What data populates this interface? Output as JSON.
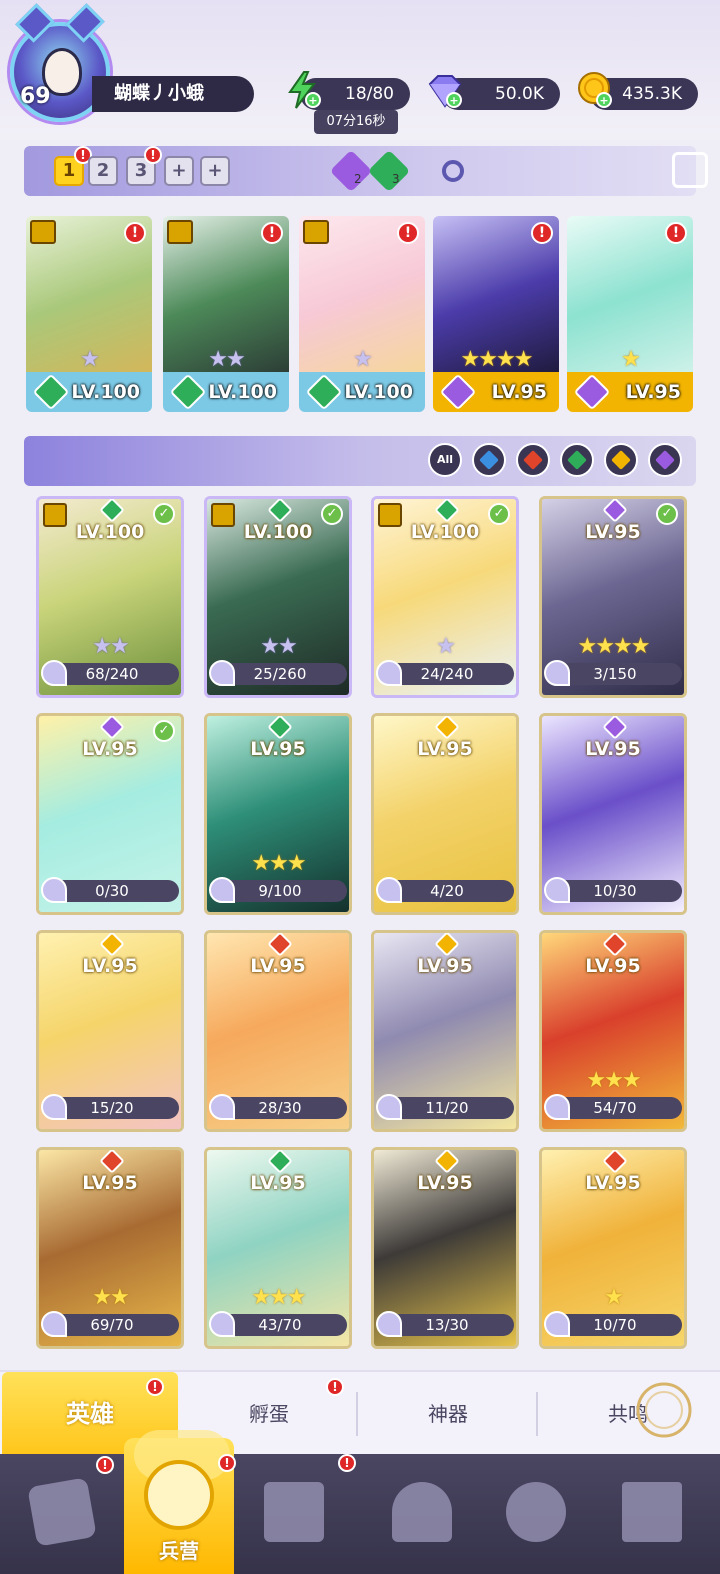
{
  "player": {
    "level": "69",
    "name": "蝴蝶丿小蛾"
  },
  "resources": {
    "energy": "18/80",
    "energy_timer": "07分16秒",
    "gems": "50.0K",
    "gold": "435.3K"
  },
  "team_tabs": [
    "1",
    "2",
    "3",
    "+",
    "+"
  ],
  "team_gems": [
    {
      "count": "2",
      "color": "#9b5be0"
    },
    {
      "count": "3",
      "color": "#2fae5a"
    }
  ],
  "team_slots": [
    {
      "level": "LV.100",
      "stars": "★",
      "element_color": "#2fae5a",
      "bar": "#7cc9e6",
      "art": "linear-gradient(160deg,#e9f2d8,#a9c87a 50%,#d5b65a)"
    },
    {
      "level": "LV.100",
      "stars": "★★",
      "element_color": "#2fae5a",
      "bar": "#7cc9e6",
      "art": "linear-gradient(160deg,#e5f0e8,#4d8a59 50%,#2b3b35)"
    },
    {
      "level": "LV.100",
      "stars": "★",
      "element_color": "#2fae5a",
      "bar": "#7cc9e6",
      "art": "linear-gradient(160deg,#fde8ee,#f7c9d6 50%,#f5d79a)"
    },
    {
      "level": "LV.95",
      "stars": "★★★★",
      "element_color": "#9b5be0",
      "bar": "#f2b400",
      "art": "linear-gradient(160deg,#c6c0f5,#4b3caa 50%,#1d1a3a)"
    },
    {
      "level": "LV.95",
      "stars": "★",
      "element_color": "#9b5be0",
      "bar": "#f2b400",
      "art": "linear-gradient(160deg,#e9fbf6,#8de2d0 50%,#d0f2ea)"
    }
  ],
  "filters": {
    "all_label": "All",
    "elements": [
      {
        "name": "water",
        "color": "#3b8fe0"
      },
      {
        "name": "fire",
        "color": "#e0442a"
      },
      {
        "name": "wind",
        "color": "#2fae5a"
      },
      {
        "name": "light",
        "color": "#f2b400"
      },
      {
        "name": "dark",
        "color": "#9b5be0"
      }
    ]
  },
  "heroes": [
    {
      "level": "LV.100",
      "fragments": "68/240",
      "stars": "★★",
      "gold_stars": false,
      "element_color": "#2fae5a",
      "checked": true,
      "ranked": true,
      "art": "linear-gradient(160deg,#f4ead0,#c9d47a 45%,#6b8f3a)"
    },
    {
      "level": "LV.100",
      "fragments": "25/260",
      "stars": "★★",
      "gold_stars": false,
      "element_color": "#2fae5a",
      "checked": true,
      "ranked": true,
      "art": "linear-gradient(160deg,#d9e8e0,#3a6b52 45%,#1e2a26)"
    },
    {
      "level": "LV.100",
      "fragments": "24/240",
      "stars": "★",
      "gold_stars": false,
      "element_color": "#2fae5a",
      "checked": true,
      "ranked": true,
      "art": "linear-gradient(160deg,#fff4d6,#f7d97a 45%,#e9f2f8)"
    },
    {
      "level": "LV.95",
      "fragments": "3/150",
      "stars": "★★★★",
      "gold_stars": true,
      "element_color": "#9b5be0",
      "checked": true,
      "ranked": false,
      "art": "linear-gradient(160deg,#d4d0e6,#6c6792 45%,#2f2c48)"
    },
    {
      "level": "LV.95",
      "fragments": "0/30",
      "stars": "",
      "gold_stars": true,
      "element_color": "#9b5be0",
      "checked": true,
      "ranked": false,
      "art": "linear-gradient(160deg,#fff1a8,#a5ece0 45%,#c6f3e9)"
    },
    {
      "level": "LV.95",
      "fragments": "9/100",
      "stars": "★★★",
      "gold_stars": true,
      "element_color": "#2fae5a",
      "checked": false,
      "ranked": false,
      "art": "linear-gradient(160deg,#bff0e0,#2e8f78 45%,#14302c)"
    },
    {
      "level": "LV.95",
      "fragments": "4/20",
      "stars": "",
      "gold_stars": true,
      "element_color": "#f2b400",
      "checked": false,
      "ranked": false,
      "art": "linear-gradient(160deg,#fff7c8,#f3d26a 45%,#e8c23e)"
    },
    {
      "level": "LV.95",
      "fragments": "10/30",
      "stars": "",
      "gold_stars": true,
      "element_color": "#9b5be0",
      "checked": false,
      "ranked": false,
      "art": "linear-gradient(160deg,#ece6ff,#6a4fc9 45%,#f4f0ff)"
    },
    {
      "level": "LV.95",
      "fragments": "15/20",
      "stars": "",
      "gold_stars": true,
      "element_color": "#f2b400",
      "checked": false,
      "ranked": false,
      "art": "linear-gradient(160deg,#fff1b0,#f5d46a 45%,#f4c4c4)"
    },
    {
      "level": "LV.95",
      "fragments": "28/30",
      "stars": "",
      "gold_stars": true,
      "element_color": "#e0442a",
      "checked": false,
      "ranked": false,
      "art": "linear-gradient(160deg,#ffe6b0,#f6a95c 45%,#f7d08a)"
    },
    {
      "level": "LV.95",
      "fragments": "11/20",
      "stars": "",
      "gold_stars": true,
      "element_color": "#f2b400",
      "checked": false,
      "ranked": false,
      "art": "linear-gradient(160deg,#e9e6f3,#8f8ab0 45%,#f4e7a0)"
    },
    {
      "level": "LV.95",
      "fragments": "54/70",
      "stars": "★★★",
      "gold_stars": true,
      "element_color": "#e0442a",
      "checked": false,
      "ranked": false,
      "art": "linear-gradient(160deg,#ffd77a,#d9402c 45%,#f2b93a)"
    },
    {
      "level": "LV.95",
      "fragments": "69/70",
      "stars": "★★",
      "gold_stars": true,
      "element_color": "#e0442a",
      "checked": false,
      "ranked": false,
      "art": "linear-gradient(160deg,#fbe6a6,#a86b32 45%,#e8b84a)"
    },
    {
      "level": "LV.95",
      "fragments": "43/70",
      "stars": "★★★",
      "gold_stars": true,
      "element_color": "#2fae5a",
      "checked": false,
      "ranked": false,
      "art": "linear-gradient(160deg,#eef9f0,#8fd3c2 45%,#f4e6a6)"
    },
    {
      "level": "LV.95",
      "fragments": "13/30",
      "stars": "",
      "gold_stars": true,
      "element_color": "#f2b400",
      "checked": false,
      "ranked": false,
      "art": "linear-gradient(160deg,#f0ead6,#3d3a38 45%,#e5c24a)"
    },
    {
      "level": "LV.95",
      "fragments": "10/70",
      "stars": "★",
      "gold_stars": true,
      "element_color": "#e0442a",
      "checked": false,
      "ranked": false,
      "art": "linear-gradient(160deg,#fff0b0,#f0b23a 45%,#f6d66a)"
    }
  ],
  "subtabs": [
    "英雄",
    "孵蛋",
    "神器",
    "共鸣"
  ],
  "nav": {
    "active_label": "兵营"
  },
  "colors": {
    "accent": "#ffc61a",
    "alert": "#e02727"
  }
}
